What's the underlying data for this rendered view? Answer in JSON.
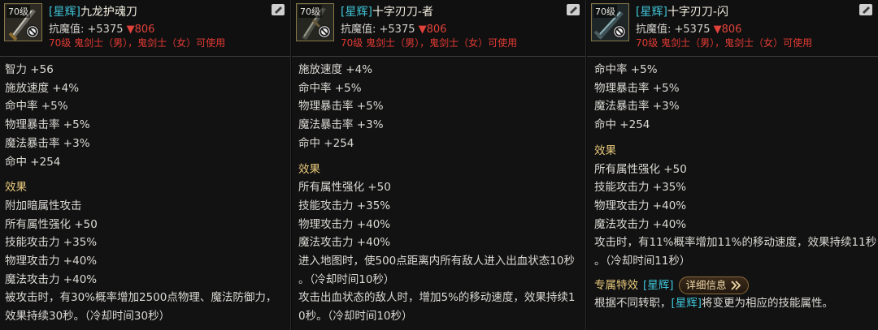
{
  "panels": [
    {
      "level": "70级",
      "tag": "[星辉]",
      "name": "九龙护魂刀",
      "anti_label": "抗魔值: +5375",
      "anti_down": "▼806",
      "requirement": "70级 鬼剑士（男），鬼剑士（女）可使用",
      "stats": [
        "智力 +56",
        "施放速度 +4%",
        "命中率 +5%",
        "物理暴击率 +5%",
        "魔法暴击率 +3%",
        "命中 +254"
      ],
      "effect_heading": "效果",
      "effects": [
        "附加暗属性攻击",
        "所有属性强化 +50",
        "技能攻击力 +35%",
        "物理攻击力 +40%",
        "魔法攻击力 +40%"
      ],
      "effect_text_1": "被攻击时，有30%概率增加2500点物理、魔法防御力，",
      "effect_text_2": "效果持续30秒。（冷却时间30秒）"
    },
    {
      "level": "70级",
      "tag": "[星辉]",
      "name": "十字刃刀-者",
      "anti_label": "抗魔值: +5375",
      "anti_down": "▼806",
      "requirement": "70级 鬼剑士（男），鬼剑士（女）可使用",
      "stats": [
        "施放速度 +4%",
        "命中率 +5%",
        "物理暴击率 +5%",
        "魔法暴击率 +3%",
        "命中 +254"
      ],
      "effect_heading": "效果",
      "effects": [
        "所有属性强化 +50",
        "技能攻击力 +35%",
        "物理攻击力 +40%",
        "魔法攻击力 +40%"
      ],
      "effect_text_1": "进入地图时，使500点距离内所有敌人进入出血状态10秒",
      "effect_text_2": "。（冷却时间10秒）",
      "effect_text_3": "攻击出血状态的敌人时，增加5%的移动速度，效果持续1",
      "effect_text_4": "0秒。（冷却时间10秒）"
    },
    {
      "level": "70级",
      "tag": "[星辉]",
      "name": "十字刃刀-闪",
      "anti_label": "抗魔值: +5375",
      "anti_down": "▼806",
      "requirement": "70级 鬼剑士（男），鬼剑士（女）可使用",
      "stats": [
        "命中率 +5%",
        "物理暴击率 +5%",
        "魔法暴击率 +3%",
        "命中 +254"
      ],
      "effect_heading": "效果",
      "effects": [
        "所有属性强化 +50",
        "技能攻击力 +35%",
        "物理攻击力 +40%",
        "魔法攻击力 +40%"
      ],
      "effect_text_1": "攻击时，有11%概率增加11%的移动速度，效果持续11秒",
      "effect_text_2": "。（冷却时间11秒）",
      "special_label": "专属特效",
      "special_tag": "[星辉]",
      "detail_button": "详细信息",
      "special_text_pre": "根据不同转职，",
      "special_text_tag": "[星辉]",
      "special_text_post": "将变更为相应的技能属性。"
    }
  ],
  "icons": {
    "ban": "prohibited-icon",
    "corner": "edit-icon",
    "weapon": "sword-icon"
  }
}
